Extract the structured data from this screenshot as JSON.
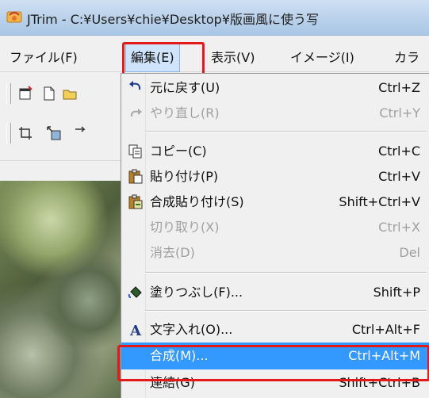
{
  "window": {
    "title": "JTrim - C:¥Users¥chie¥Desktop¥版画風に使う写"
  },
  "menubar": {
    "items": [
      {
        "label": "ファイル(F)"
      },
      {
        "label": "編集(E)"
      },
      {
        "label": "表示(V)"
      },
      {
        "label": "イメージ(I)"
      },
      {
        "label": "カラ"
      }
    ]
  },
  "edit_menu": {
    "items": [
      {
        "label": "元に戻す(U)",
        "shortcut": "Ctrl+Z",
        "icon": "undo-icon",
        "enabled": true
      },
      {
        "label": "やり直し(R)",
        "shortcut": "Ctrl+Y",
        "icon": "redo-icon",
        "enabled": false
      },
      {
        "label": "コピー(C)",
        "shortcut": "Ctrl+C",
        "icon": "copy-icon",
        "enabled": true
      },
      {
        "label": "貼り付け(P)",
        "shortcut": "Ctrl+V",
        "icon": "paste-icon",
        "enabled": true
      },
      {
        "label": "合成貼り付け(S)",
        "shortcut": "Shift+Ctrl+V",
        "icon": "composite-paste-icon",
        "enabled": true
      },
      {
        "label": "切り取り(X)",
        "shortcut": "Ctrl+X",
        "icon": "",
        "enabled": false
      },
      {
        "label": "消去(D)",
        "shortcut": "Del",
        "icon": "",
        "enabled": false
      },
      {
        "label": "塗りつぶし(F)...",
        "shortcut": "Shift+P",
        "icon": "fill-bucket-icon",
        "enabled": true
      },
      {
        "label": "文字入れ(O)...",
        "shortcut": "Ctrl+Alt+F",
        "icon": "text-tool-icon",
        "enabled": true
      },
      {
        "label": "合成(M)...",
        "shortcut": "Ctrl+Alt+M",
        "icon": "",
        "enabled": true,
        "selected": true
      },
      {
        "label": "連結(G)",
        "shortcut": "Shift+Ctrl+B",
        "icon": "",
        "enabled": true
      }
    ]
  },
  "colors": {
    "highlight_red": "#e31a1a",
    "selection_blue": "#3399ff",
    "disabled_text": "#a0a0a0"
  }
}
